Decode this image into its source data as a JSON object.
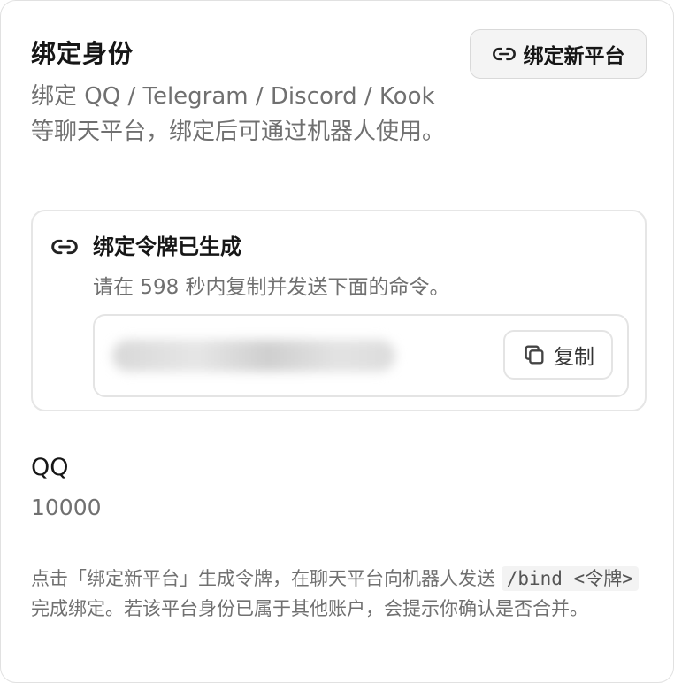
{
  "header": {
    "title": "绑定身份",
    "description": "绑定 QQ / Telegram / Discord / Kook 等聊天平台，绑定后可通过机器人使用。",
    "bind_button_label": "绑定新平台",
    "bind_button_icon": "link-icon"
  },
  "token_panel": {
    "icon": "link-icon",
    "title": "绑定令牌已生成",
    "hint": "请在 598 秒内复制并发送下面的命令。",
    "copy_label": "复制",
    "copy_icon": "copy-icon"
  },
  "platform": {
    "name": "QQ",
    "id": "10000"
  },
  "footer": {
    "text_1": "点击「绑定新平台」生成令牌，在聊天平台向机器人发送 ",
    "code": "/bind <令牌>",
    "text_2": " 完成绑定。若该平台身份已属于其他账户，会提示你确认是否合并。"
  }
}
